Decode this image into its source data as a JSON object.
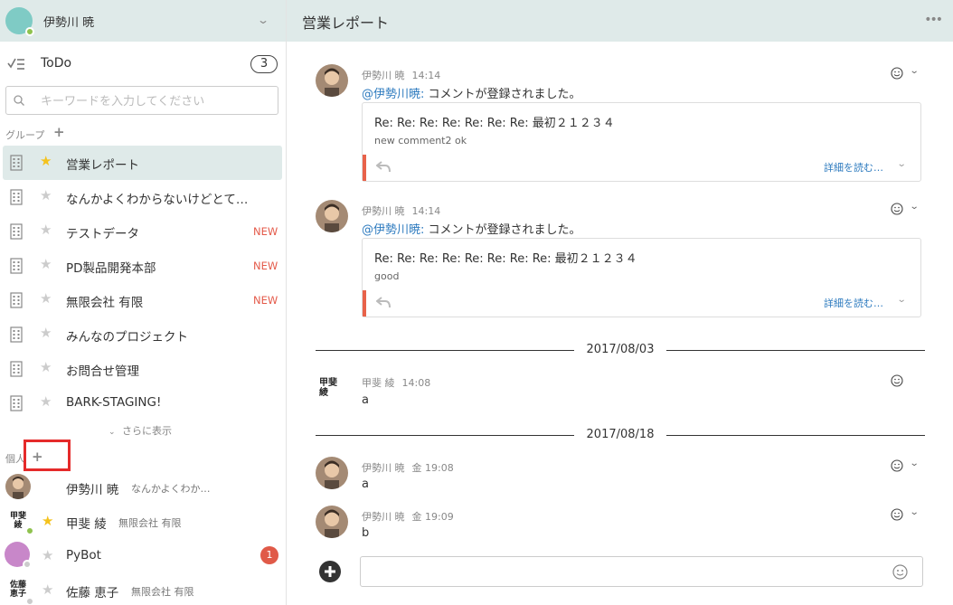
{
  "sidebar": {
    "user": {
      "name": "伊勢川 暁",
      "avatar_color": "#7fcbc5",
      "status_color": "#8fc24e"
    },
    "todo": {
      "label": "ToDo",
      "count": "3"
    },
    "search": {
      "placeholder": "キーワードを入力してください"
    },
    "groups_label": "グループ",
    "groups": [
      {
        "name": "営業レポート",
        "favorite": true,
        "active": true,
        "badge": ""
      },
      {
        "name": "なんかよくわからないけどとて…",
        "favorite": false,
        "active": false,
        "badge": ""
      },
      {
        "name": "テストデータ",
        "favorite": false,
        "active": false,
        "badge": "NEW"
      },
      {
        "name": "PD製品開発本部",
        "favorite": false,
        "active": false,
        "badge": "NEW"
      },
      {
        "name": "無限会社 有限",
        "favorite": false,
        "active": false,
        "badge": "NEW"
      },
      {
        "name": "みんなのプロジェクト",
        "favorite": false,
        "active": false,
        "badge": ""
      },
      {
        "name": "お問合せ管理",
        "favorite": false,
        "active": false,
        "badge": ""
      },
      {
        "name": "BARK-STAGING!",
        "favorite": false,
        "active": false,
        "badge": ""
      }
    ],
    "more_label": "さらに表示",
    "personal_label": "個人",
    "dms": [
      {
        "name": "伊勢川 暁",
        "sub": "なんかよくわか…",
        "favorite": null,
        "avatar": "photo",
        "status": ""
      },
      {
        "name": "甲斐 綾",
        "sub": "無限会社 有限",
        "favorite": true,
        "avatar_text": "甲斐\n綾",
        "status": "#8fc24e"
      },
      {
        "name": "PyBot",
        "sub": "",
        "favorite": false,
        "avatar_color": "#c887c9",
        "status": "#cccccc",
        "unread": "1"
      },
      {
        "name": "佐藤 恵子",
        "sub": "無限会社 有限",
        "favorite": false,
        "avatar_text": "佐藤\n恵子",
        "status": "#cccccc"
      }
    ]
  },
  "main": {
    "title": "営業レポート",
    "messages": [
      {
        "author": "伊勢川 暁",
        "time": "14:14",
        "mention": "@伊勢川暁:",
        "text": "コメントが登録されました。",
        "quote": {
          "title": "Re: Re: Re: Re: Re: Re: Re: 最初２１２３４",
          "text": "new comment2 ok",
          "read_more": "詳細を読む…"
        }
      },
      {
        "author": "伊勢川 暁",
        "time": "14:14",
        "mention": "@伊勢川暁:",
        "text": "コメントが登録されました。",
        "quote": {
          "title": "Re: Re: Re: Re: Re: Re: Re: Re: 最初２１２３４",
          "text": "good",
          "read_more": "詳細を読む…"
        }
      },
      {
        "date_separator": "2017/08/03"
      },
      {
        "author": "甲斐 綾",
        "time": "14:08",
        "avatar_text": "甲斐\n綾",
        "text": "a"
      },
      {
        "date_separator": "2017/08/18"
      },
      {
        "author": "伊勢川 暁",
        "time": "金 19:08",
        "text": "a"
      },
      {
        "author": "伊勢川 暁",
        "time": "金 19:09",
        "text": "b"
      }
    ],
    "composer": {
      "placeholder": ""
    }
  },
  "colors": {
    "header_bg": "#dfeae9",
    "accent_red": "#e8624a",
    "link": "#2e7bbf",
    "highlight": "#e52a2a",
    "star_fav": "#f4c21c"
  }
}
